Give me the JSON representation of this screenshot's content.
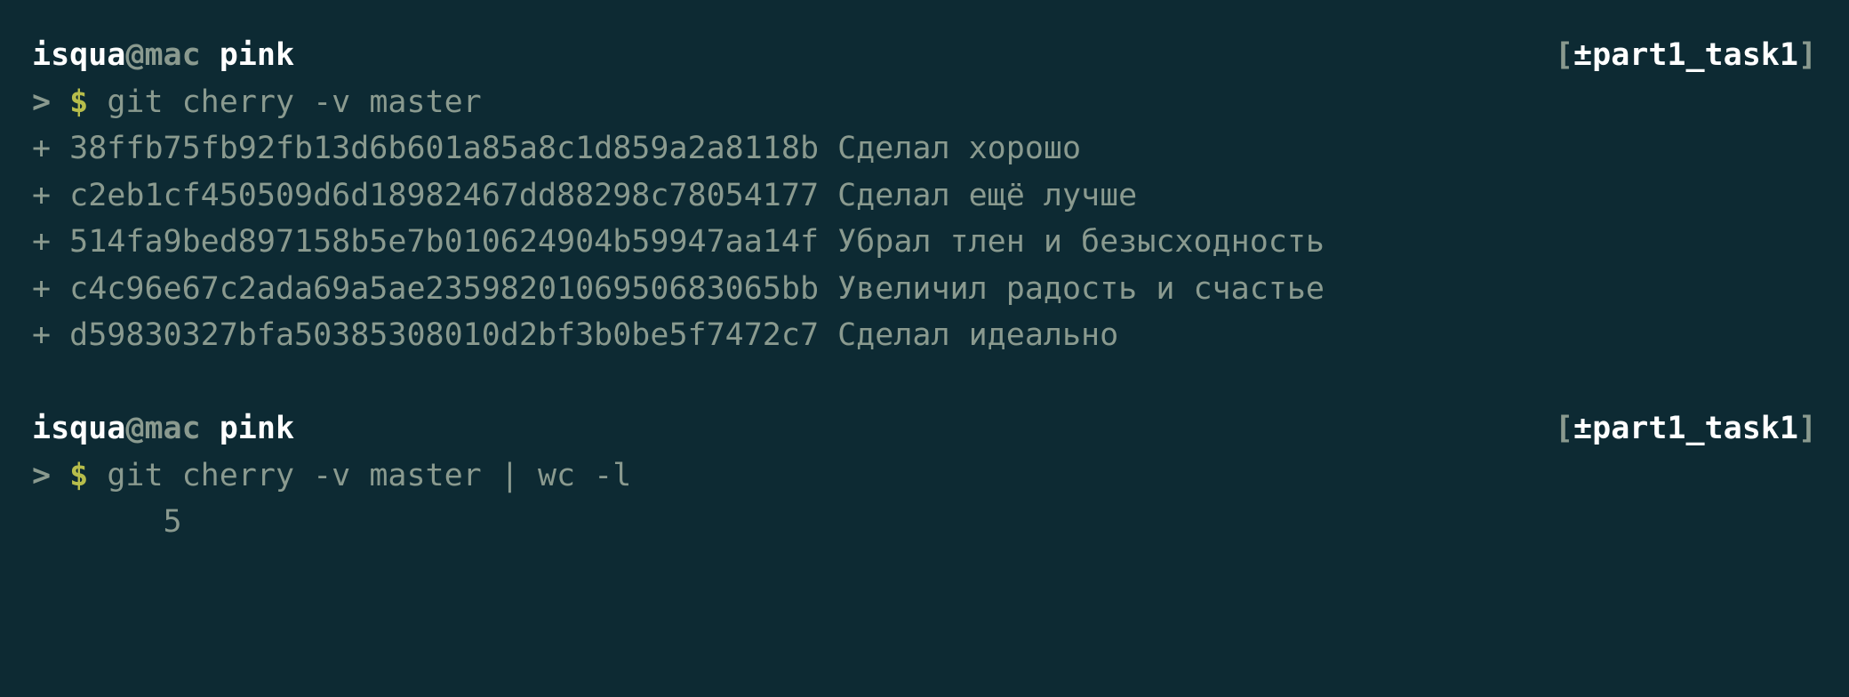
{
  "colors": {
    "background": "#0d2a33",
    "white": "#ffffff",
    "muted": "#8a9a8f",
    "dollar": "#b7bd4b"
  },
  "prompt1": {
    "user": "isqua",
    "at": "@",
    "host": "mac",
    "sep": " ",
    "dir": "pink",
    "bracket_open": "[",
    "plusminus": "±",
    "branch": "part1_task1",
    "bracket_close": "]"
  },
  "cmd1": {
    "gt": "> ",
    "dollar": "$",
    "sp": " ",
    "text": "git cherry -v master"
  },
  "commits": [
    {
      "plus": "+ ",
      "hash": "38ffb75fb92fb13d6b601a85a8c1d859a2a8118b",
      "sp": " ",
      "msg": "Сделал хорошо"
    },
    {
      "plus": "+ ",
      "hash": "c2eb1cf450509d6d18982467dd88298c78054177",
      "sp": " ",
      "msg": "Сделал ещё лучше"
    },
    {
      "plus": "+ ",
      "hash": "514fa9bed897158b5e7b010624904b59947aa14f",
      "sp": " ",
      "msg": "Убрал тлен и безысходность"
    },
    {
      "plus": "+ ",
      "hash": "c4c96e67c2ada69a5ae2359820106950683065bb",
      "sp": " ",
      "msg": "Увеличил радость и счастье"
    },
    {
      "plus": "+ ",
      "hash": "d59830327bfa50385308010d2bf3b0be5f7472c7",
      "sp": " ",
      "msg": "Сделал идеально"
    }
  ],
  "prompt2": {
    "user": "isqua",
    "at": "@",
    "host": "mac",
    "sep": " ",
    "dir": "pink",
    "bracket_open": "[",
    "plusminus": "±",
    "branch": "part1_task1",
    "bracket_close": "]"
  },
  "cmd2": {
    "gt": "> ",
    "dollar": "$",
    "sp": " ",
    "text": "git cherry -v master | wc -l"
  },
  "wc_output": "       5"
}
